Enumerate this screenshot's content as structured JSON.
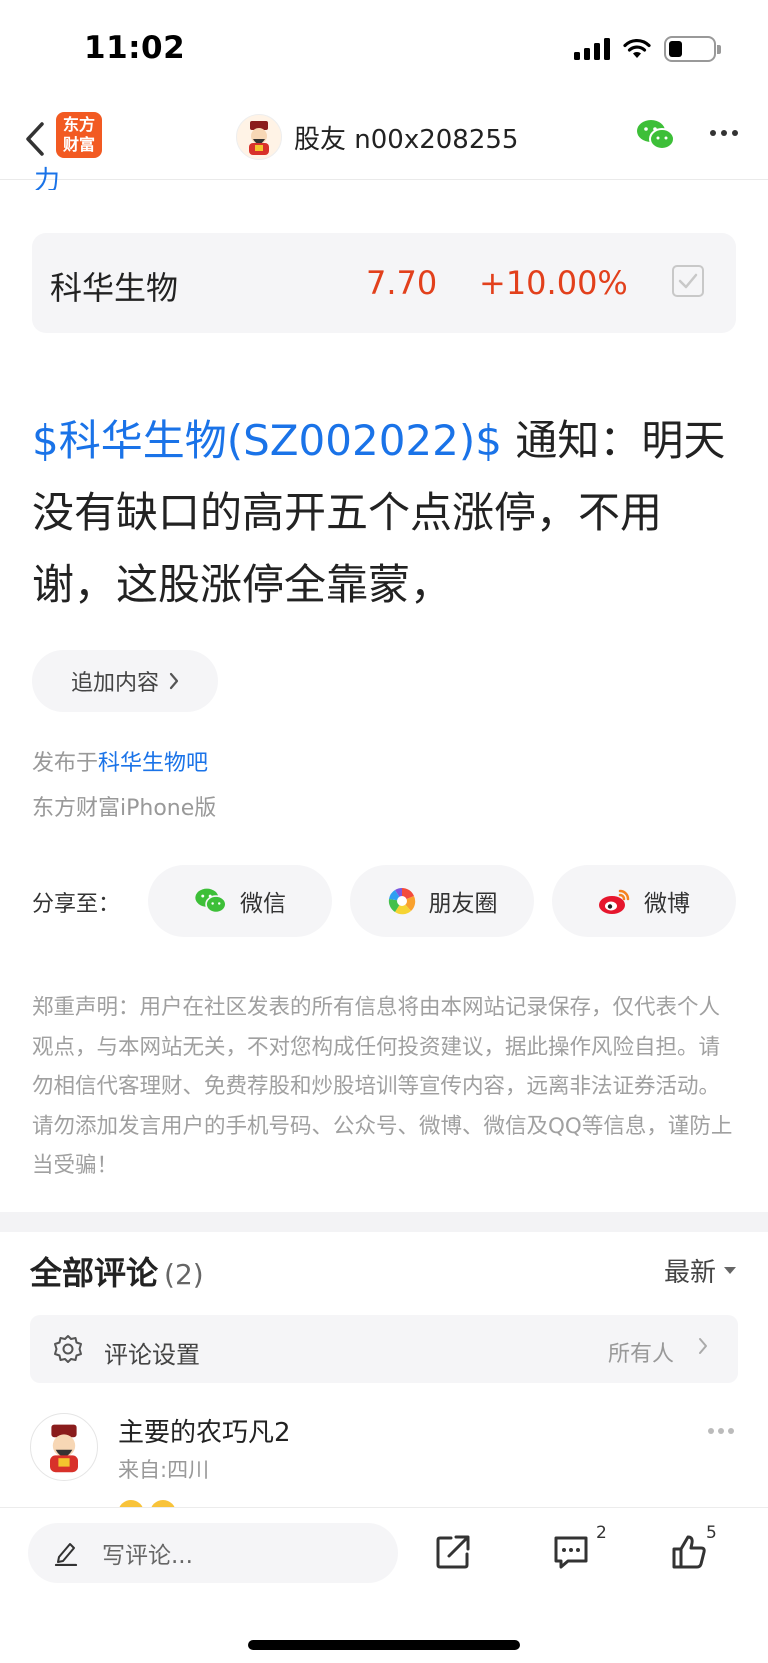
{
  "status_bar": {
    "time": "11:02"
  },
  "nav": {
    "logo_line1": "东方",
    "logo_line2": "财富",
    "title": "股友 n00x208255"
  },
  "truncated_text": "力",
  "stock": {
    "name": "科华生物",
    "price": "7.70",
    "change": "+10.00%"
  },
  "post": {
    "stock_link": "$科华生物(SZ002022)$",
    "text": " 通知：明天没有缺口的高开五个点涨停，不用谢，这股涨停全靠蒙，"
  },
  "append_button": {
    "label": "追加内容"
  },
  "meta": {
    "published_prefix": "发布于",
    "bar_name": "科华生物吧",
    "platform": "东方财富iPhone版"
  },
  "share": {
    "label": "分享至：",
    "wechat": "微信",
    "moments": "朋友圈",
    "weibo": "微博"
  },
  "disclaimer": "郑重声明：用户在社区发表的所有信息将由本网站记录保存，仅代表个人观点，与本网站无关，不对您构成任何投资建议，据此操作风险自担。请勿相信代客理财、免费荐股和炒股培训等宣传内容，远离非法证券活动。请勿添加发言用户的手机号码、公众号、微博、微信及QQ等信息，谨防上当受骗！",
  "comments": {
    "title": "全部评论",
    "count": "(2)",
    "sort": "最新",
    "settings_label": "评论设置",
    "settings_value": "所有人",
    "items": [
      {
        "name": "主要的农巧凡2",
        "from": "来自:四川"
      }
    ]
  },
  "bottom_bar": {
    "write_placeholder": "写评论...",
    "comment_count": "2",
    "like_count": "5"
  },
  "colors": {
    "accent_blue": "#1a73e8",
    "stock_up_red": "#e2401c",
    "brand_orange": "#f25a22",
    "wechat_green": "#3dbf38"
  },
  "icons": [
    "back-icon",
    "wechat-icon",
    "more-icon",
    "checkbox-icon",
    "chevron-right-icon",
    "moments-icon",
    "weibo-icon",
    "gear-icon",
    "pencil-icon",
    "share-icon",
    "comment-icon",
    "thumbs-up-icon"
  ]
}
